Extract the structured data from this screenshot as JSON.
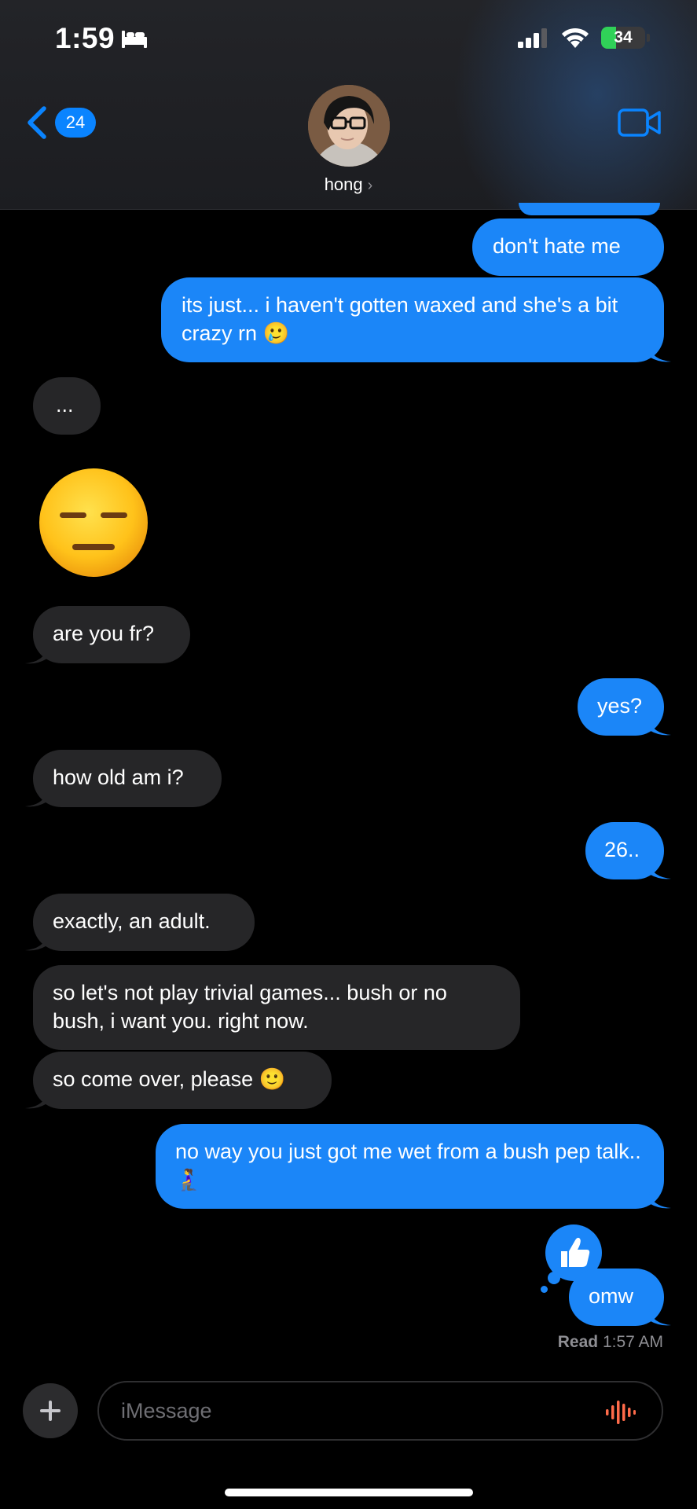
{
  "status_bar": {
    "time": "1:59",
    "battery": "34",
    "battery_level": 0.34
  },
  "nav": {
    "back_count": "24",
    "contact_name": "hong"
  },
  "messages": [
    {
      "side": "out",
      "text": "don't hate me"
    },
    {
      "side": "out",
      "text": "its just... i haven't gotten waxed and she's a bit crazy rn 🥲"
    },
    {
      "side": "in",
      "text": "..."
    },
    {
      "side": "in",
      "text": "😑"
    },
    {
      "side": "in",
      "text": "are you fr?"
    },
    {
      "side": "out",
      "text": "yes?"
    },
    {
      "side": "in",
      "text": "how old am i?"
    },
    {
      "side": "out",
      "text": "26.."
    },
    {
      "side": "in",
      "text": "exactly, an adult."
    },
    {
      "side": "in",
      "text": "so let's not play trivial games... bush or no bush, i want you. right now."
    },
    {
      "side": "in",
      "text": "so come over, please 🙂"
    },
    {
      "side": "out",
      "text": "no way you just got me wet from a bush pep talk.. 🧎‍♀️"
    },
    {
      "side": "out",
      "text": "omw",
      "tapback": "thumbs-up-icon"
    }
  ],
  "receipt": {
    "label": "Read",
    "time": "1:57 AM"
  },
  "composer": {
    "placeholder": "iMessage"
  },
  "colors": {
    "outgoing_bubble": "#1b86f8",
    "incoming_bubble": "#262628",
    "accent": "#0a84ff",
    "audio_icon": "#ff6b4a"
  }
}
